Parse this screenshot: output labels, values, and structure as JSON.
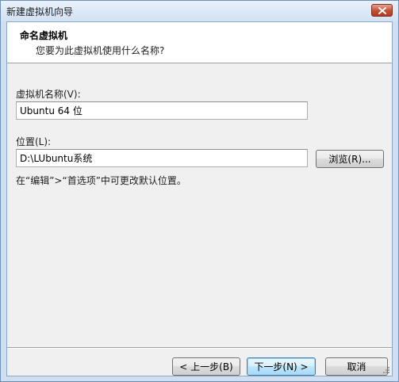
{
  "window": {
    "title": "新建虚拟机向导"
  },
  "header": {
    "title": "命名虚拟机",
    "subtitle": "您要为此虚拟机使用什么名称?"
  },
  "form": {
    "name_label": "虚拟机名称(V):",
    "name_value": "Ubuntu 64 位",
    "location_label": "位置(L):",
    "location_value": "D:\\LUbuntu系统",
    "browse_label": "浏览(R)...",
    "hint": "在“编辑”>“首选项”中可更改默认位置。"
  },
  "footer": {
    "back_label": "< 上一步(B)",
    "next_label": "下一步(N) >",
    "cancel_label": "取消"
  }
}
